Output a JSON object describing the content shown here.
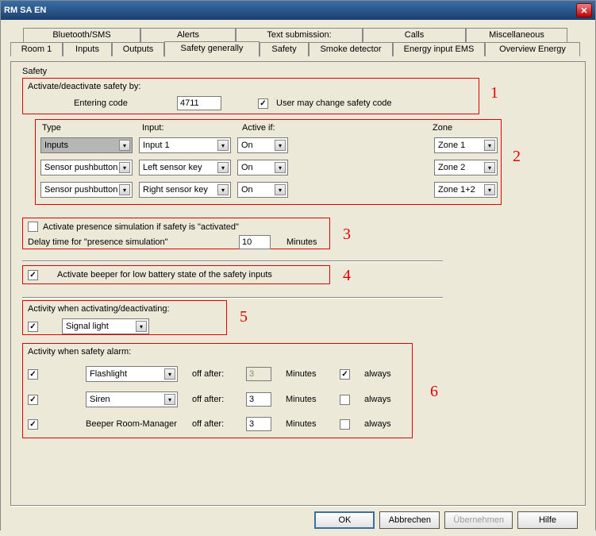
{
  "window": {
    "title": "RM SA EN"
  },
  "tabs_row1": [
    "Bluetooth/SMS",
    "Alerts",
    "Text submission:",
    "Calls",
    "Miscellaneous"
  ],
  "tabs_row2": [
    "Room 1",
    "Inputs",
    "Outputs",
    "Safety generally",
    "Safety",
    "Smoke detector",
    "Energy input EMS",
    "Overview Energy"
  ],
  "active_tab": "Safety generally",
  "safety_header": "Safety",
  "sec1": {
    "title": "Activate/deactivate safety by:",
    "entering_label": "Entering code",
    "code": "4711",
    "user_change_label": "User may change safety code",
    "user_change_checked": true
  },
  "sec2": {
    "headers": {
      "type": "Type",
      "input": "Input:",
      "active": "Active if:",
      "zone": "Zone"
    },
    "rows": [
      {
        "type": "Inputs",
        "selected": true,
        "input": "Input 1",
        "active": "On",
        "zone": "Zone 1"
      },
      {
        "type": "Sensor pushbutton",
        "selected": false,
        "input": "Left sensor key",
        "active": "On",
        "zone": "Zone 2"
      },
      {
        "type": "Sensor pushbutton",
        "selected": false,
        "input": "Right sensor key",
        "active": "On",
        "zone": "Zone 1+2"
      }
    ]
  },
  "sec3": {
    "check_label": "Activate presence simulation if safety is \"activated\"",
    "checked": false,
    "delay_label": "Delay time for \"presence simulation\"",
    "delay_value": "10",
    "minutes": "Minutes"
  },
  "sec4": {
    "label": "Activate beeper for low battery state of the safety inputs",
    "checked": true
  },
  "sec5": {
    "title": "Activity when activating/deactivating:",
    "checked": true,
    "dropdown": "Signal light"
  },
  "sec6": {
    "title": "Activity when safety alarm:",
    "off_after": "off after:",
    "minutes": "Minutes",
    "always": "always",
    "rows": [
      {
        "checked": true,
        "name": "Flashlight",
        "is_dropdown": true,
        "value": "3",
        "value_disabled": true,
        "always": true
      },
      {
        "checked": true,
        "name": "Siren",
        "is_dropdown": true,
        "value": "3",
        "value_disabled": false,
        "always": false
      },
      {
        "checked": true,
        "name": "Beeper Room-Manager",
        "is_dropdown": false,
        "value": "3",
        "value_disabled": false,
        "always": false
      }
    ]
  },
  "annotations": {
    "1": "1",
    "2": "2",
    "3": "3",
    "4": "4",
    "5": "5",
    "6": "6"
  },
  "buttons": {
    "ok": "OK",
    "cancel": "Abbrechen",
    "apply": "Übernehmen",
    "help": "Hilfe"
  }
}
